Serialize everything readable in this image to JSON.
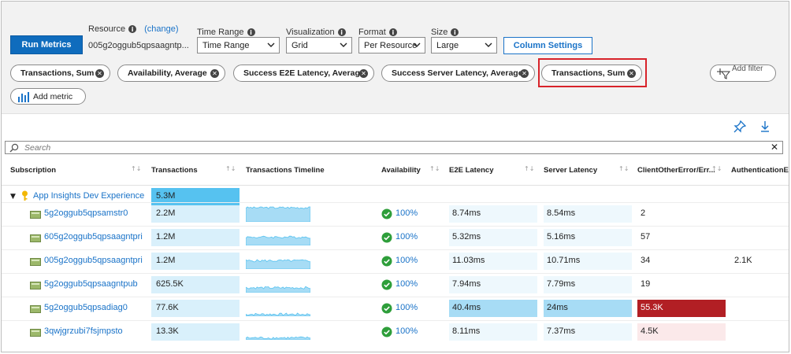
{
  "toolbar": {
    "run_label": "Run Metrics",
    "resource_label": "Resource",
    "change_label": "(change)",
    "resource_value": "005g2oggub5qpsaagntp...",
    "time_range_label": "Time Range",
    "time_range_value": "Time Range",
    "visualization_label": "Visualization",
    "visualization_value": "Grid",
    "format_label": "Format",
    "format_value": "Per Resource",
    "size_label": "Size",
    "size_value": "Large",
    "column_settings_label": "Column Settings"
  },
  "metric_chips": [
    {
      "label": "Transactions, Sum"
    },
    {
      "label": "Availability, Average"
    },
    {
      "label": "Success E2E Latency, Average"
    },
    {
      "label": "Success Server Latency, Average"
    },
    {
      "label": "Transactions, Sum"
    }
  ],
  "add_filter_label": "Add filter",
  "add_metric_label": "Add metric",
  "search": {
    "placeholder": "Search",
    "clear": "✕"
  },
  "columns": [
    {
      "label": "Subscription"
    },
    {
      "label": "Transactions"
    },
    {
      "label": "Transactions Timeline"
    },
    {
      "label": "Availability"
    },
    {
      "label": "E2E Latency"
    },
    {
      "label": "Server Latency"
    },
    {
      "label": "ClientOtherError/Err..."
    },
    {
      "label": "AuthenticationErr"
    }
  ],
  "group": {
    "toggle": "▼",
    "name": "App Insights Dev Experience",
    "transactions": "5.3M",
    "transactions_fraction": 1.0
  },
  "rows": [
    {
      "name": "5g2oggub5qpsamstr0",
      "transactions": "2.2M",
      "tx_fraction": 0.415,
      "availability": "100%",
      "e2e": "8.74ms",
      "server": "8.54ms",
      "client_other": "2",
      "auth": "",
      "e2e_level": 0.22,
      "server_level": 0.36,
      "client_level": 0.0
    },
    {
      "name": "605g2oggub5qpsaagntpri",
      "transactions": "1.2M",
      "tx_fraction": 0.226,
      "availability": "100%",
      "e2e": "5.32ms",
      "server": "5.16ms",
      "client_other": "57",
      "auth": "",
      "e2e_level": 0.13,
      "server_level": 0.21,
      "client_level": 0.001
    },
    {
      "name": "005g2oggub5qpsaagntpri",
      "transactions": "1.2M",
      "tx_fraction": 0.226,
      "availability": "100%",
      "e2e": "11.03ms",
      "server": "10.71ms",
      "client_other": "34",
      "auth": "2.1K",
      "e2e_level": 0.27,
      "server_level": 0.45,
      "client_level": 0.0
    },
    {
      "name": "5g2oggub5qpsaagntpub",
      "transactions": "625.5K",
      "tx_fraction": 0.118,
      "availability": "100%",
      "e2e": "7.94ms",
      "server": "7.79ms",
      "client_other": "19",
      "auth": "",
      "e2e_level": 0.2,
      "server_level": 0.32,
      "client_level": 0.0
    },
    {
      "name": "5g2oggub5qpsadiag0",
      "transactions": "77.6K",
      "tx_fraction": 0.015,
      "availability": "100%",
      "e2e": "40.4ms",
      "server": "24ms",
      "client_other": "55.3K",
      "auth": "",
      "e2e_level": 1.0,
      "server_level": 1.0,
      "client_level": 1.0
    },
    {
      "name": "3qwjgrzubi7fsjmpsto",
      "transactions": "13.3K",
      "tx_fraction": 0.003,
      "availability": "100%",
      "e2e": "8.11ms",
      "server": "7.37ms",
      "client_other": "4.5K",
      "auth": "",
      "e2e_level": 0.2,
      "server_level": 0.3,
      "client_level": 0.08
    }
  ],
  "colors": {
    "accent": "#0f6cbd",
    "link": "#1a73c8",
    "bar_strong": "#56c2f0",
    "bar_light": "#d9f0fb",
    "error_strong": "#b21f24",
    "error_light": "#fbe9ea",
    "success": "#2e9e3a",
    "highlight_border": "#d8232a"
  },
  "icons": {
    "pin": "pin-icon",
    "download": "download-icon",
    "search": "search-icon",
    "filter": "filter-icon",
    "metric": "bar-chart-icon",
    "key": "key-icon",
    "resource": "storage-account-icon",
    "check": "check-circle-icon"
  }
}
